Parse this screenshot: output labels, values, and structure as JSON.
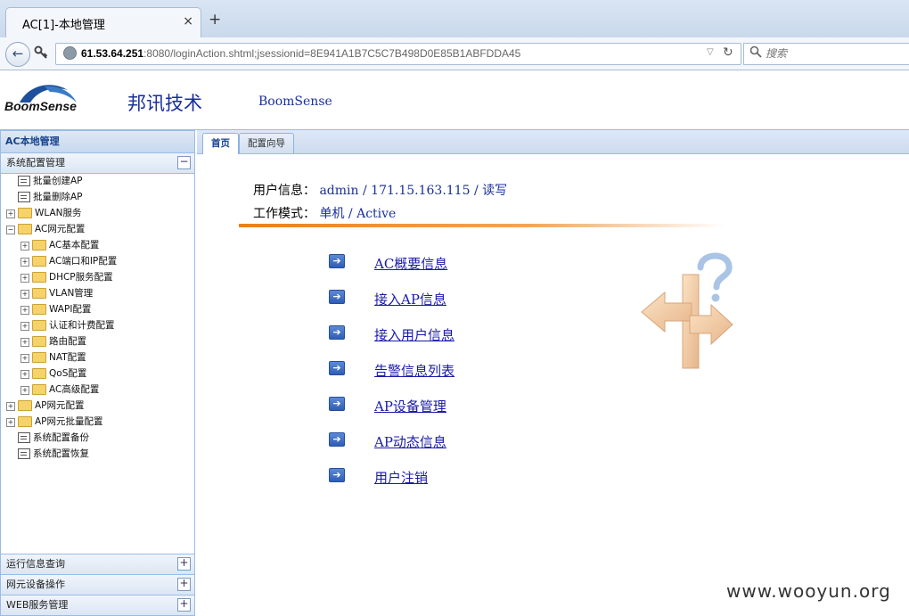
{
  "browser": {
    "tab_title": "AC[1]-本地管理",
    "tab_close": "×",
    "new_tab": "+",
    "back": "←",
    "url_host": "61.53.64.251",
    "url_path": ":8080/loginAction.shtml;jsessionid=8E941A1B7C5C7B498D0E85B1ABFDDA45",
    "search_placeholder": "搜索"
  },
  "header": {
    "logo_text": "BoomSense",
    "brand_cn": "邦讯技术",
    "brand_en": "BoomSense"
  },
  "sidebar": {
    "title": "AC本地管理",
    "active_panel": "系统配置管理",
    "active_panel_toggle": "−",
    "tree": [
      {
        "label": "批量创建AP",
        "level": 1,
        "type": "leaf"
      },
      {
        "label": "批量删除AP",
        "level": 1,
        "type": "leaf"
      },
      {
        "label": "WLAN服务",
        "level": 0,
        "type": "folder",
        "toggle": "+"
      },
      {
        "label": "AC网元配置",
        "level": 0,
        "type": "folder",
        "toggle": "−"
      },
      {
        "label": "AC基本配置",
        "level": 1,
        "type": "folder",
        "toggle": "+"
      },
      {
        "label": "AC端口和IP配置",
        "level": 1,
        "type": "folder",
        "toggle": "+"
      },
      {
        "label": "DHCP服务配置",
        "level": 1,
        "type": "folder",
        "toggle": "+"
      },
      {
        "label": "VLAN管理",
        "level": 1,
        "type": "folder",
        "toggle": "+"
      },
      {
        "label": "WAPI配置",
        "level": 1,
        "type": "folder",
        "toggle": "+"
      },
      {
        "label": "认证和计费配置",
        "level": 1,
        "type": "folder",
        "toggle": "+"
      },
      {
        "label": "路由配置",
        "level": 1,
        "type": "folder",
        "toggle": "+"
      },
      {
        "label": "NAT配置",
        "level": 1,
        "type": "folder",
        "toggle": "+"
      },
      {
        "label": "QoS配置",
        "level": 1,
        "type": "folder",
        "toggle": "+"
      },
      {
        "label": "AC高级配置",
        "level": 1,
        "type": "folder",
        "toggle": "+"
      },
      {
        "label": "AP网元配置",
        "level": 0,
        "type": "folder",
        "toggle": "+"
      },
      {
        "label": "AP网元批量配置",
        "level": 0,
        "type": "folder",
        "toggle": "+"
      },
      {
        "label": "系统配置备份",
        "level": 1,
        "type": "leaf"
      },
      {
        "label": "系统配置恢复",
        "level": 1,
        "type": "leaf"
      }
    ],
    "bottom_panels": [
      {
        "label": "运行信息查询",
        "toggle": "+"
      },
      {
        "label": "网元设备操作",
        "toggle": "+"
      },
      {
        "label": "WEB服务管理",
        "toggle": "+"
      }
    ]
  },
  "tabs": {
    "home": "首页",
    "wizard": "配置向导"
  },
  "userinfo": {
    "user_label": "用户信息：",
    "username": "admin",
    "sep": "/",
    "ip": "171.15.163.115",
    "permission": "读写",
    "mode_label": "工作模式：",
    "mode": "单机",
    "state": "Active"
  },
  "links": [
    "AC概要信息",
    "接入AP信息",
    "接入用户信息",
    "告警信息列表",
    "AP设备管理",
    "AP动态信息",
    "用户注销"
  ],
  "watermark": "www.wooyun.org",
  "colors": {
    "brand_blue": "#1a2f9c",
    "accent_orange": "#e8811a",
    "panel_border": "#99bbe8"
  }
}
